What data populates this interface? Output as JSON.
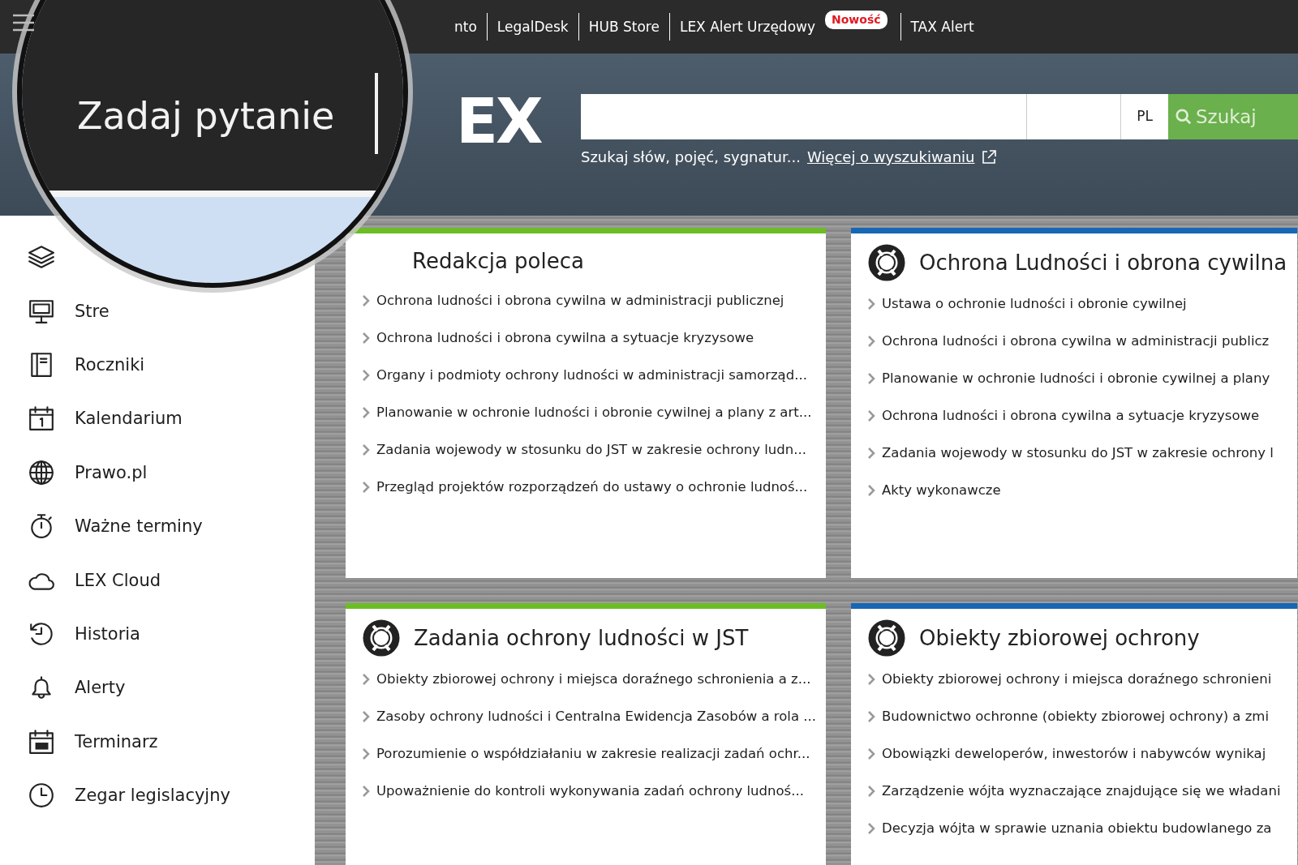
{
  "top_nav": {
    "items": [
      {
        "label": "nto"
      },
      {
        "label": "LegalDesk"
      },
      {
        "label": "HUB Store"
      },
      {
        "label": "LEX Alert Urzędowy",
        "badge": "Nowość"
      },
      {
        "label": "TAX Alert"
      }
    ]
  },
  "magnifier": {
    "label": "Zadaj pytanie"
  },
  "logo": {
    "text": "EX"
  },
  "search": {
    "language": "PL",
    "button": "Szukaj",
    "hint": "Szukaj słów, pojęć, sygnatur...",
    "help_link": "Więcej o wyszukiwaniu"
  },
  "sidebar": {
    "items": [
      {
        "kind": "layers"
      },
      {
        "kind": "monitor",
        "label": "Stre"
      },
      {
        "kind": "book",
        "label": "Roczniki"
      },
      {
        "kind": "calendar",
        "label": "Kalendarium"
      },
      {
        "kind": "globe",
        "label": "Prawo.pl"
      },
      {
        "kind": "stopwatch",
        "label": "Ważne terminy"
      },
      {
        "kind": "cloud",
        "label": "LEX Cloud"
      },
      {
        "kind": "history",
        "label": "Historia"
      },
      {
        "kind": "bell",
        "label": "Alerty"
      },
      {
        "kind": "planner",
        "label": "Terminarz"
      },
      {
        "kind": "clock",
        "label": "Zegar legislacyjny"
      }
    ]
  },
  "panels": [
    {
      "title": "Redakcja poleca",
      "kind": "plain",
      "color": "#6cbd25",
      "links": [
        "Ochrona ludności i obrona cywilna w administracji publicznej",
        "Ochrona ludności i obrona cywilna a sytuacje kryzysowe",
        "Organy i podmioty ochrony ludności w administracji samorząd...",
        "Planowanie w ochronie ludności i obronie cywilnej a plany z art...",
        "Zadania wojewody w stosunku do JST w zakresie ochrony ludn...",
        "Przegląd projektów rozporządzeń do ustawy o ochronie ludnoś..."
      ]
    },
    {
      "title": "Ochrona Ludności i obrona cywilna",
      "kind": "lifebuoy",
      "color": "#1767b5",
      "links": [
        "Ustawa o ochronie ludności i obronie cywilnej",
        "Ochrona ludności i obrona cywilna w administracji publicz",
        "Planowanie w ochronie ludności i obronie cywilnej a plany",
        "Ochrona ludności i obrona cywilna a sytuacje kryzysowe",
        "Zadania wojewody w stosunku do JST w zakresie ochrony l",
        "Akty wykonawcze"
      ]
    },
    {
      "title": "Zadania ochrony ludności w JST",
      "kind": "lifebuoy",
      "color": "#6cbd25",
      "links": [
        "Obiekty zbiorowej ochrony i miejsca doraźnego schronienia a z...",
        "Zasoby ochrony ludności i Centralna Ewidencja Zasobów a rola ...",
        "Porozumienie o współdziałaniu w zakresie realizacji zadań ochr...",
        "Upoważnienie do kontroli wykonywania zadań ochrony ludnoś..."
      ]
    },
    {
      "title": "Obiekty zbiorowej ochrony",
      "kind": "lifebuoy",
      "color": "#1767b5",
      "links": [
        "Obiekty zbiorowej ochrony i miejsca doraźnego schronieni",
        "Budownictwo ochronne (obiekty zbiorowej ochrony) a zmi",
        "Obowiązki deweloperów, inwestorów i nabywców wynikaj",
        "Zarządzenie wójta wyznaczające znajdujące się we władani",
        "Decyzja wójta w sprawie uznania obiektu budowlanego za"
      ]
    }
  ]
}
